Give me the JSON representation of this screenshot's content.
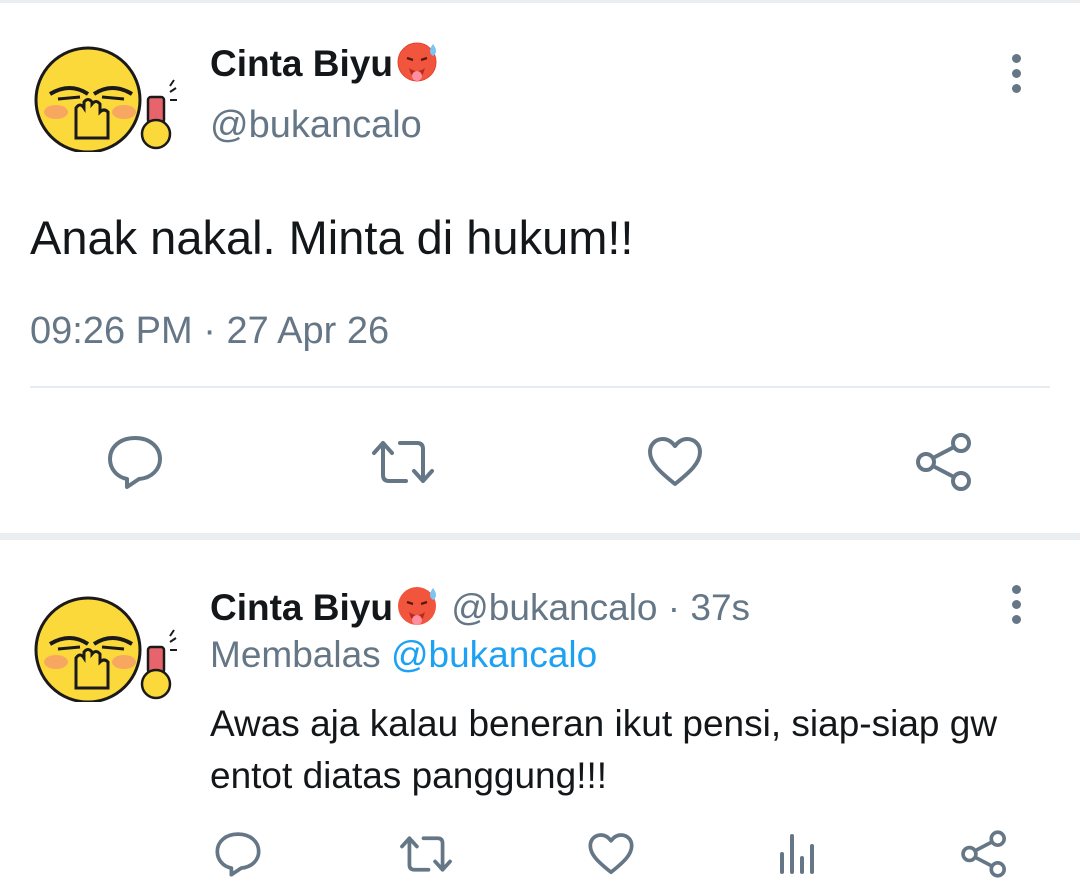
{
  "tweet": {
    "name": "Cinta Biyu",
    "handle": "@bukancalo",
    "text": "Anak nakal. Minta di hukum!!",
    "time": "09:26 PM",
    "date_sep": " · ",
    "date": "27 Apr 26"
  },
  "reply": {
    "name": "Cinta Biyu",
    "handle": "@bukancalo",
    "dot": " · ",
    "time": "37s",
    "replying_label": "Membalas ",
    "replying_to": "@bukancalo",
    "text": "Awas aja kalau beneran ikut pensi, siap-siap gw entot diatas panggung!!!"
  },
  "icons": {
    "reply": "reply-icon",
    "retweet": "retweet-icon",
    "like": "heart-icon",
    "share": "share-icon",
    "stats": "stats-icon",
    "menu": "more-vertical-icon",
    "emoji": "hot-face-emoji"
  },
  "colors": {
    "text": "#14171a",
    "secondary": "#657786",
    "link": "#1da1f2",
    "avatar_face": "#fbd93a",
    "divider": "#e6ecf0"
  }
}
